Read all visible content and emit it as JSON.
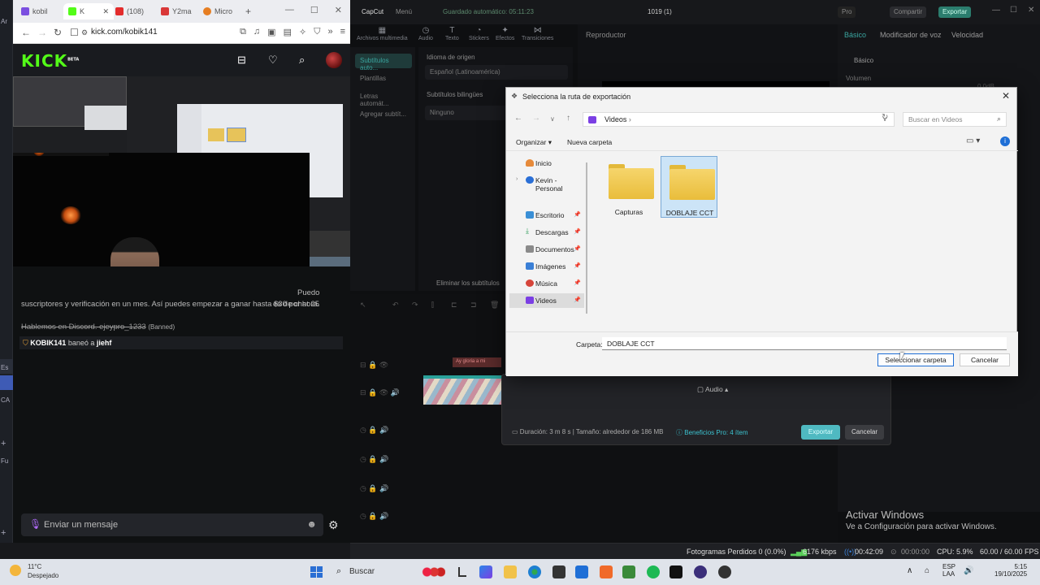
{
  "browser": {
    "tabs": [
      {
        "label": "kobil",
        "color": "#7b4fe0"
      },
      {
        "label": "K",
        "color": "#53fc18"
      },
      {
        "label": "(108)",
        "color": "#e32c2c"
      },
      {
        "label": "Y2ma",
        "color": "#d93838"
      },
      {
        "label": "Micro",
        "color": "#e67e22"
      }
    ],
    "new_tab": "+",
    "url": "kick.com/kobik141",
    "window_controls": [
      "—",
      "☐",
      "✕"
    ]
  },
  "kick": {
    "logo": "KICK",
    "logo_badge": "BETA",
    "chat": {
      "lines": [
        {
          "text": "Puedo"
        },
        {
          "text": "suscriptores y verificación en un mes. Así puedes empezar a ganar hasta $30 por hora.",
          "suffix": "es de chat 25"
        },
        {
          "text": "Hablemos en Discord. ejeypro_1233",
          "badge": "(Banned)"
        }
      ],
      "ban_message": {
        "user": "KOBIK141",
        "action": "baneó a",
        "target": "jiehf"
      },
      "input_placeholder": "Enviar un mensaje"
    }
  },
  "capcut": {
    "app_name": "CapCut",
    "menu": "Menú",
    "autosave": "Guardado automático: 05:11:23",
    "project_title": "1019 (1)",
    "pro_label": "Pro",
    "share_label": "Compartir",
    "export_label": "Exportar",
    "toolbar": [
      "Archivos multimedia",
      "Audio",
      "Texto",
      "Stickers",
      "Efectos",
      "Transiciones"
    ],
    "left_items": [
      "Subtítulos auto...",
      "Plantillas",
      "Letras automát...",
      "Agregar subtít..."
    ],
    "mid": {
      "source_lang_label": "Idioma de origen",
      "source_lang_value": "Español (Latinoamérica)",
      "bilingual_label": "Subtítulos bilingües",
      "bilingual_value": "Ninguno",
      "remove_label": "Eliminar los subtítulos"
    },
    "player_label": "Reproductor",
    "right_tabs": [
      "Básico",
      "Modificador de voz",
      "Velocidad"
    ],
    "right_section": "Básico",
    "volume_label": "Volumen",
    "volume_value": "0.0dB",
    "clip_label": "Ay gloria a mi"
  },
  "export_dialog": {
    "audio_label": "Audio",
    "info": "Duración: 3 m 8 s | Tamaño: alrededor de 186 MB",
    "pro_benefits": "Beneficios Pro: 4 ítem",
    "export_button": "Exportar",
    "cancel_button": "Cancelar"
  },
  "folder_dialog": {
    "title": "Selecciona la ruta de exportación",
    "path": "Videos",
    "search_placeholder": "Buscar en Videos",
    "organize": "Organizar",
    "new_folder": "Nueva carpeta",
    "nav_items": [
      {
        "label": "Inicio",
        "icon": "home-icon",
        "color": "#e68a3a",
        "pinned": false,
        "expandable": false
      },
      {
        "label": "Kevin - Personal",
        "icon": "onedrive-icon",
        "color": "#2a6fd6",
        "pinned": false,
        "expandable": true
      },
      {
        "label": "Escritorio",
        "icon": "desktop-icon",
        "color": "#3a8fd6",
        "pinned": true,
        "expandable": false
      },
      {
        "label": "Descargas",
        "icon": "download-icon",
        "color": "#2f9c5a",
        "pinned": true,
        "expandable": false
      },
      {
        "label": "Documentos",
        "icon": "documents-icon",
        "color": "#8a8a8a",
        "pinned": true,
        "expandable": false
      },
      {
        "label": "Imágenes",
        "icon": "pictures-icon",
        "color": "#3a7fd6",
        "pinned": true,
        "expandable": false
      },
      {
        "label": "Música",
        "icon": "music-icon",
        "color": "#d6453a",
        "pinned": true,
        "expandable": false
      },
      {
        "label": "Videos",
        "icon": "videos-icon",
        "color": "#7b3fe4",
        "pinned": true,
        "expandable": false,
        "selected": true
      }
    ],
    "folders": [
      {
        "name": "Capturas",
        "selected": false
      },
      {
        "name": "DOBLAJE CCT",
        "selected": true
      }
    ],
    "folder_label": "Carpeta:",
    "folder_value": "DOBLAJE CCT",
    "select_button": "Seleccionar carpeta",
    "cancel_button": "Cancelar"
  },
  "activate_windows": {
    "title": "Activar Windows",
    "subtitle": "Ve a Configuración para activar Windows."
  },
  "obs_status": {
    "dropped_frames": "Fotogramas Perdidos 0 (0.0%)",
    "bitrate": "6176 kbps",
    "stream_time": "00:42:09",
    "rec_time": "00:00:00",
    "cpu": "CPU: 5.9%",
    "fps": "60.00 / 60.00 FPS"
  },
  "taskbar": {
    "weather_temp": "11°C",
    "weather_desc": "Despejado",
    "search_label": "Buscar",
    "lang_top": "ESP",
    "lang_bottom": "LAA",
    "time": "5:15",
    "date": "19/10/2025"
  }
}
